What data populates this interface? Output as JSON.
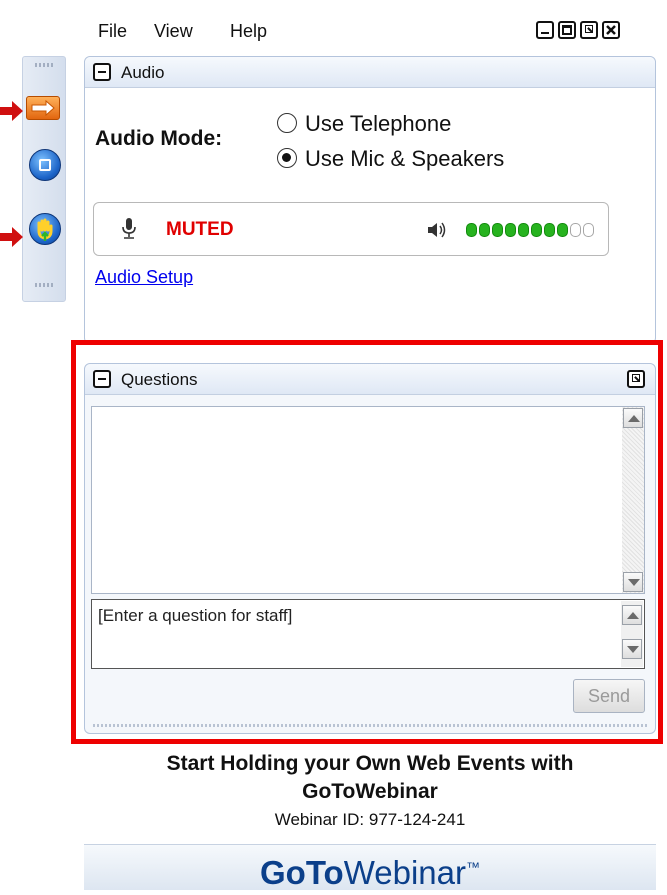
{
  "menubar": {
    "items": [
      "File",
      "View",
      "Help"
    ]
  },
  "window_controls": [
    "minimize-icon",
    "maximize-icon",
    "restore-icon",
    "close-icon"
  ],
  "audio": {
    "title": "Audio",
    "mode_label": "Audio Mode:",
    "options": [
      "Use Telephone",
      "Use Mic & Speakers"
    ],
    "selected": "Use Mic & Speakers",
    "mic_status": "MUTED",
    "speaker_level": {
      "filled": 8,
      "total": 10
    },
    "setup_link": "Audio Setup"
  },
  "questions": {
    "title": "Questions",
    "input_placeholder": "[Enter a question for staff]",
    "send_label": "Send"
  },
  "promo": {
    "line1": "Start Holding your Own Web Events with",
    "line2": "GoToWebinar",
    "webinar_id": "Webinar ID: 977-124-241"
  },
  "brand": {
    "bold": "GoTo",
    "light": "Webinar",
    "tm": "™"
  },
  "colors": {
    "accent_blue": "#0b3f8a",
    "muted_red": "#e00000",
    "level_green": "#27b31f",
    "highlight_red": "#ee0000",
    "link_blue": "#0000ee"
  }
}
